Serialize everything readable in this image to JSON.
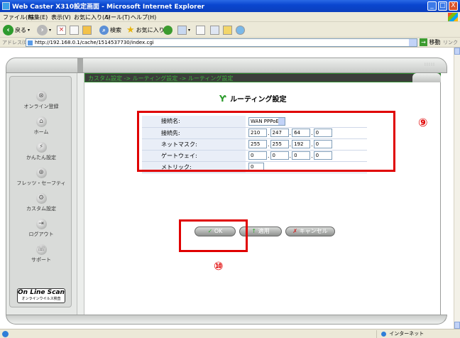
{
  "window": {
    "title": "Web Caster X310設定画面 - Microsoft Internet Explorer",
    "minimize": "_",
    "maximize": "□",
    "close": "X"
  },
  "menu": [
    "ファイル(F)",
    "編集(E)",
    "表示(V)",
    "お気に入り(A)",
    "ツール(T)",
    "ヘルプ(H)"
  ],
  "toolbar": {
    "back_label": "戻る",
    "search_label": "検索",
    "favorites_label": "お気に入り"
  },
  "address": {
    "label": "アドレス(D)",
    "url": "http://192.168.0.1/cache/1514537730/index.cgi",
    "go_label": "移動",
    "links_label": "リンク"
  },
  "sidebar": {
    "items": [
      {
        "label": "オンライン登録",
        "icon": "online-registration-icon"
      },
      {
        "label": "ホーム",
        "icon": "home-icon"
      },
      {
        "label": "かんたん設定",
        "icon": "easy-setup-icon"
      },
      {
        "label": "フレッツ・セーフティ",
        "icon": "flets-safety-icon"
      },
      {
        "label": "カスタム設定",
        "icon": "custom-settings-icon"
      },
      {
        "label": "ログアウト",
        "icon": "logout-icon"
      },
      {
        "label": "サポート",
        "icon": "support-icon"
      }
    ],
    "online_scan_title": "On Line Scan",
    "online_scan_sub": "オンラインウイルス検査"
  },
  "breadcrumb": "カスタム設定 -> ルーティング設定 -> ルーティング設定",
  "page_title": "ルーティング設定",
  "form": {
    "connection_name_label": "接続名:",
    "connection_name_value": "WAN PPPoE 3",
    "destination_label": "接続先:",
    "destination": [
      "210",
      "247",
      "64",
      "0"
    ],
    "netmask_label": "ネットマスク:",
    "netmask": [
      "255",
      "255",
      "192",
      "0"
    ],
    "gateway_label": "ゲートウェイ:",
    "gateway": [
      "0",
      "0",
      "0",
      "0"
    ],
    "metric_label": "メトリック:",
    "metric_value": "0"
  },
  "buttons": {
    "ok_label": "OK",
    "apply_label": "適用",
    "cancel_label": "キャンセル"
  },
  "annotations": {
    "form_marker": "⑨",
    "ok_marker": "⑩",
    "color": "#e00000"
  },
  "status": {
    "zone_label": "インターネット"
  }
}
